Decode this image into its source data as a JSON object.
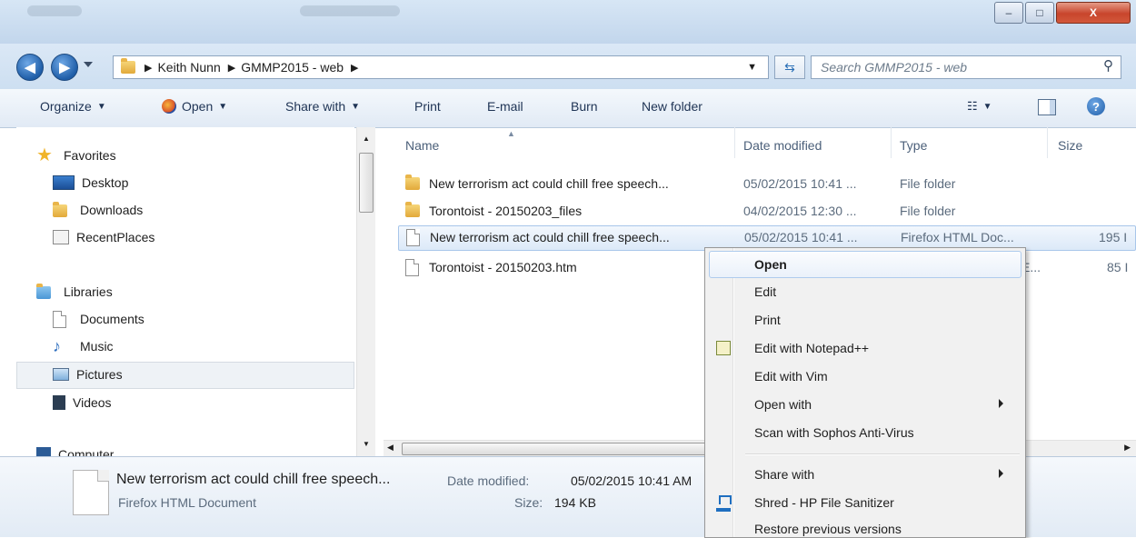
{
  "window": {
    "controls": {
      "minimize": "–",
      "maximize": "□",
      "close": "X"
    }
  },
  "address_bar": {
    "back_icon": "back-arrow",
    "forward_icon": "forward-arrow",
    "breadcrumb": [
      "Keith Nunn",
      "GMMP2015 - web"
    ],
    "search_placeholder": "Search GMMP2015 - web"
  },
  "toolbar": {
    "organize": "Organize",
    "open": "Open",
    "share_with": "Share with",
    "print": "Print",
    "email": "E-mail",
    "burn": "Burn",
    "new_folder": "New folder"
  },
  "nav": {
    "favorites": "Favorites",
    "desktop": "Desktop",
    "downloads": "Downloads",
    "recent_places": "RecentPlaces",
    "libraries": "Libraries",
    "documents": "Documents",
    "music": "Music",
    "pictures": "Pictures",
    "videos": "Videos",
    "computer": "Computer"
  },
  "columns": {
    "name": "Name",
    "date": "Date modified",
    "type": "Type",
    "size": "Size"
  },
  "files": [
    {
      "name": "New terrorism act could chill free speech...",
      "date": "05/02/2015 10:41 ...",
      "type": "File folder",
      "size": "",
      "icon": "folder"
    },
    {
      "name": "Torontoist - 20150203_files",
      "date": "04/02/2015 12:30 ...",
      "type": "File folder",
      "size": "",
      "icon": "folder"
    },
    {
      "name": "New terrorism act could chill free speech...",
      "date": "05/02/2015 10:41 ...",
      "type": "Firefox HTML Doc...",
      "size": "195 I",
      "icon": "document",
      "selected": true
    },
    {
      "name": "Torontoist - 20150203.htm",
      "date": "",
      "type": "E...",
      "size": "85 I",
      "icon": "document"
    }
  ],
  "details": {
    "filename": "New terrorism act could chill free speech...",
    "date_label": "Date modified:",
    "date_value": "05/02/2015 10:41 AM",
    "type": "Firefox HTML Document",
    "size_label": "Size:",
    "size_value": "194 KB"
  },
  "context_menu": {
    "items": {
      "open": "Open",
      "edit": "Edit",
      "print": "Print",
      "edit_notepadpp": "Edit with Notepad++",
      "edit_vim": "Edit with Vim",
      "open_with": "Open with",
      "scan_sophos": "Scan with Sophos Anti-Virus",
      "share_with": "Share with",
      "shred": "Shred - HP File Sanitizer",
      "restore": "Restore previous versions"
    }
  }
}
